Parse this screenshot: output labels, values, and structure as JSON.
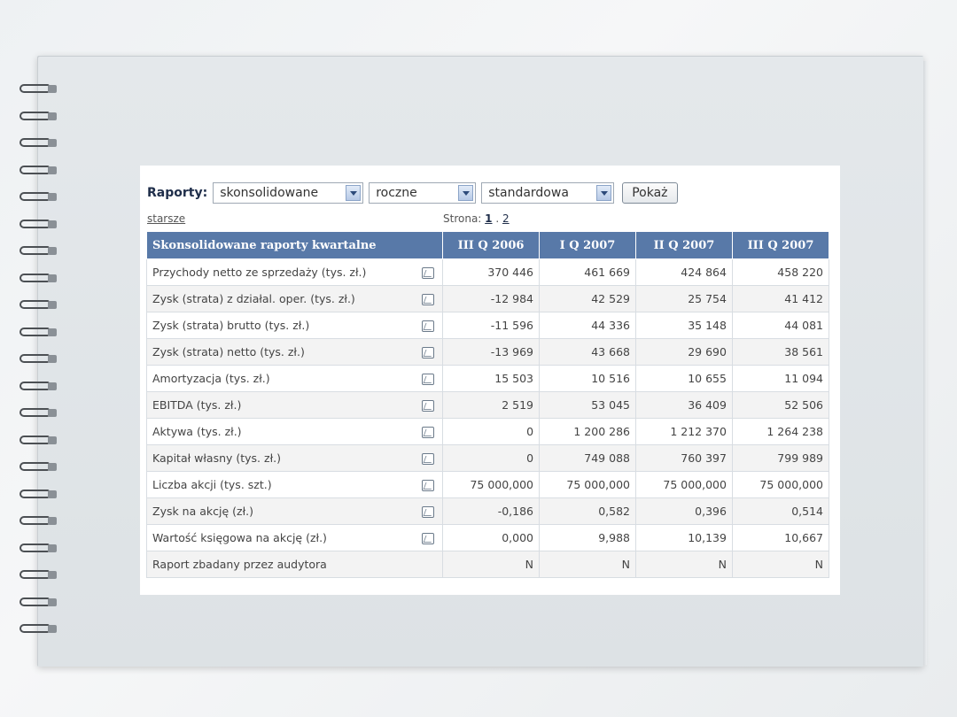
{
  "toolbar": {
    "label": "Raporty:",
    "select1": "skonsolidowane",
    "select2": "roczne",
    "select3": "standardowa",
    "button": "Pokaż"
  },
  "nav": {
    "older": "starsze",
    "page_label": "Strona:",
    "page1": "1",
    "separator": ".",
    "page2": "2"
  },
  "table": {
    "header": "Skonsolidowane raporty kwartalne",
    "columns": [
      "III Q 2006",
      "I Q 2007",
      "II Q 2007",
      "III Q 2007"
    ],
    "rows": [
      {
        "label": "Przychody netto ze sprzedaży (tys. zł.)",
        "chart": true,
        "values": [
          "370 446",
          "461 669",
          "424 864",
          "458 220"
        ]
      },
      {
        "label": "Zysk (strata) z działal. oper. (tys. zł.)",
        "chart": true,
        "values": [
          "-12 984",
          "42 529",
          "25 754",
          "41 412"
        ]
      },
      {
        "label": "Zysk (strata) brutto (tys. zł.)",
        "chart": true,
        "values": [
          "-11 596",
          "44 336",
          "35 148",
          "44 081"
        ]
      },
      {
        "label": "Zysk (strata) netto (tys. zł.)",
        "chart": true,
        "values": [
          "-13 969",
          "43 668",
          "29 690",
          "38 561"
        ]
      },
      {
        "label": "Amortyzacja (tys. zł.)",
        "chart": true,
        "values": [
          "15 503",
          "10 516",
          "10 655",
          "11 094"
        ]
      },
      {
        "label": "EBITDA (tys. zł.)",
        "chart": true,
        "values": [
          "2 519",
          "53 045",
          "36 409",
          "52 506"
        ]
      },
      {
        "label": "Aktywa (tys. zł.)",
        "chart": true,
        "values": [
          "0",
          "1 200 286",
          "1 212 370",
          "1 264 238"
        ]
      },
      {
        "label": "Kapitał własny (tys. zł.)",
        "chart": true,
        "values": [
          "0",
          "749 088",
          "760 397",
          "799 989"
        ]
      },
      {
        "label": "Liczba akcji (tys. szt.)",
        "chart": true,
        "values": [
          "75 000,000",
          "75 000,000",
          "75 000,000",
          "75 000,000"
        ]
      },
      {
        "label": "Zysk na akcję (zł.)",
        "chart": true,
        "values": [
          "-0,186",
          "0,582",
          "0,396",
          "0,514"
        ]
      },
      {
        "label": "Wartość księgowa na akcję (zł.)",
        "chart": true,
        "values": [
          "0,000",
          "9,988",
          "10,139",
          "10,667"
        ]
      },
      {
        "label": "Raport zbadany przez audytora",
        "chart": false,
        "values": [
          "N",
          "N",
          "N",
          "N"
        ]
      }
    ]
  },
  "icons": {
    "chart": "line-chart-icon",
    "dropdown": "chevron-down-icon"
  },
  "colors": {
    "header_bg": "#5879a8",
    "header_text": "#ffffff",
    "alt_row": "#f3f3f3"
  }
}
